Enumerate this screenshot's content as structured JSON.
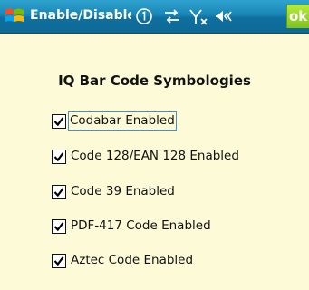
{
  "titlebar": {
    "title": "Enable/Disable Sy",
    "ok_label": "ok"
  },
  "heading": "IQ Bar Code Symbologies",
  "options": [
    {
      "label": "Codabar Enabled",
      "checked": true
    },
    {
      "label": "Code 128/EAN 128 Enabled",
      "checked": true
    },
    {
      "label": "Code 39 Enabled",
      "checked": true
    },
    {
      "label": "PDF-417 Code Enabled",
      "checked": true
    },
    {
      "label": "Aztec Code Enabled",
      "checked": true
    }
  ],
  "colors": {
    "titlebar": "#1a86b6",
    "background": "#fdfbd7",
    "ok_button": "#8fd020"
  }
}
